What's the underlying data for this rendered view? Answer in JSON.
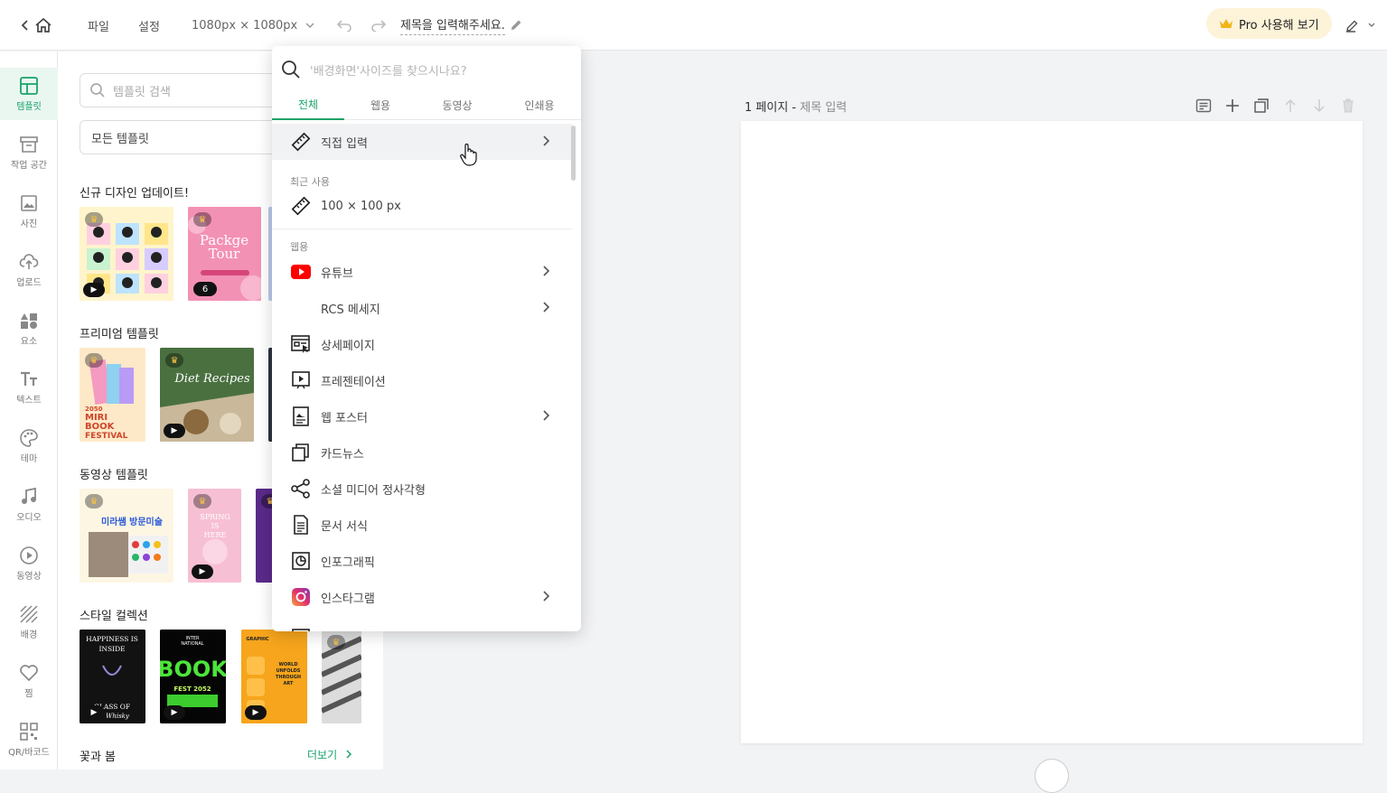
{
  "topbar": {
    "file": "파일",
    "settings": "설정",
    "size": "1080px × 1080px",
    "title": "제목을 입력해주세요.",
    "pro": "Pro 사용해 보기"
  },
  "rail": [
    {
      "label": "템플릿",
      "icon": "template-icon"
    },
    {
      "label": "작업 공간",
      "icon": "workspace-icon"
    },
    {
      "label": "사진",
      "icon": "photo-icon"
    },
    {
      "label": "업로드",
      "icon": "upload-icon"
    },
    {
      "label": "요소",
      "icon": "elements-icon"
    },
    {
      "label": "텍스트",
      "icon": "text-icon"
    },
    {
      "label": "테마",
      "icon": "palette-icon"
    },
    {
      "label": "오디오",
      "icon": "music-icon"
    },
    {
      "label": "동영상",
      "icon": "play-circle-icon"
    },
    {
      "label": "배경",
      "icon": "background-icon"
    },
    {
      "label": "찜",
      "icon": "heart-icon"
    },
    {
      "label": "QR/바코드",
      "icon": "qr-icon"
    }
  ],
  "panel": {
    "search_placeholder": "템플릿 검색",
    "filter": "모든 템플릿",
    "sections": [
      "신규 디자인 업데이트!",
      "프리미엄 템플릿",
      "동영상 템플릿",
      "스타일 컬렉션",
      "꽃과 봄"
    ],
    "more": "더보기",
    "page_count": "6",
    "thumb_texts": {
      "package_tour_1": "Packge",
      "package_tour_2": "Tour",
      "miri_1": "2050",
      "miri_2": "MIRI",
      "miri_3": "BOOK",
      "miri_4": "FESTIVAL",
      "diet": "Diet Recipes",
      "art_class": "미라쌤 방문미술",
      "spring_1": "SPRING",
      "spring_2": "IS",
      "spring_3": "HERE",
      "happiness_1": "HAPPINESS IS",
      "happiness_2": "INSIDE",
      "happiness_3": "GLASS OF",
      "happiness_4": "Whisky",
      "bookfest_1": "INTER",
      "bookfest_2": "NATIONAL",
      "bookfest_3": "BOOK",
      "bookfest_4": "FEST 2052",
      "graphic_1": "GRAPHIC",
      "graphic_2": "WORLD",
      "graphic_3": "UNFOLDS",
      "graphic_4": "THROUGH",
      "graphic_5": "ART"
    }
  },
  "canvas": {
    "page": "1 페이지",
    "sep": " - ",
    "title": "제목 입력"
  },
  "dropdown": {
    "search_placeholder": "'배경화면'사이즈를 찾으시나요?",
    "tabs": [
      "전체",
      "웹용",
      "동영상",
      "인쇄용"
    ],
    "custom": "직접 입력",
    "recent_label": "최근 사용",
    "recent_item": "100 × 100 px",
    "web_label": "웹용",
    "items": [
      {
        "label": "유튜브",
        "icon": "youtube-icon",
        "chevron": true
      },
      {
        "label": "RCS 메세지",
        "icon": "",
        "chevron": true
      },
      {
        "label": "상세페이지",
        "icon": "detail-page-icon",
        "chevron": false
      },
      {
        "label": "프레젠테이션",
        "icon": "presentation-icon",
        "chevron": false
      },
      {
        "label": "웹 포스터",
        "icon": "poster-icon",
        "chevron": true
      },
      {
        "label": "카드뉴스",
        "icon": "cards-icon",
        "chevron": false
      },
      {
        "label": "소셜 미디어 정사각형",
        "icon": "share-icon",
        "chevron": false
      },
      {
        "label": "문서 서식",
        "icon": "document-icon",
        "chevron": false
      },
      {
        "label": "인포그래픽",
        "icon": "infographic-icon",
        "chevron": false
      },
      {
        "label": "인스타그램",
        "icon": "instagram-icon",
        "chevron": true
      }
    ],
    "colors": {
      "accent": "#1aa36a",
      "youtube": "#ff0000"
    }
  }
}
